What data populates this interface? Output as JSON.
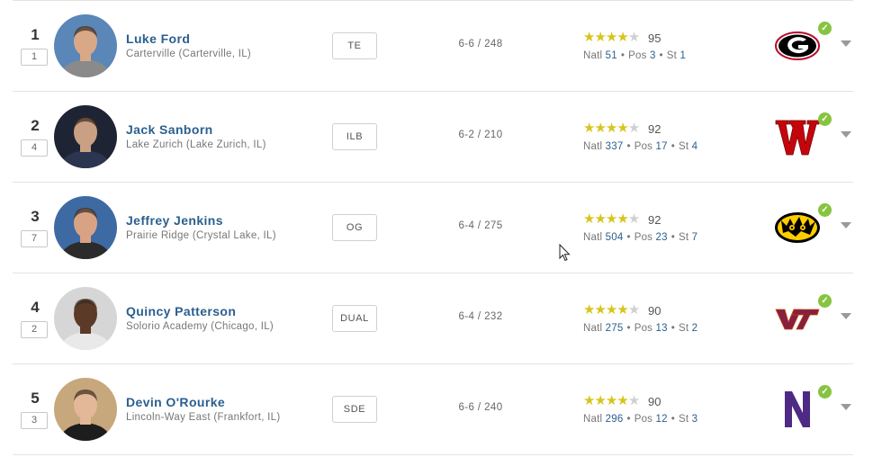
{
  "recruits": [
    {
      "rank": "1",
      "prev_rank": "1",
      "name": "Luke Ford",
      "school": "Carterville (Carterville, IL)",
      "position": "TE",
      "ht_wt": "6-6 / 248",
      "rating": "95",
      "stars_on": 4,
      "natl": "51",
      "pos_rank": "3",
      "st_rank": "1",
      "commit": "georgia-logo",
      "avatar_bg": "#5a86b8",
      "skin": "#d9a887",
      "shirt": "#8a8a8a"
    },
    {
      "rank": "2",
      "prev_rank": "4",
      "name": "Jack Sanborn",
      "school": "Lake Zurich (Lake Zurich, IL)",
      "position": "ILB",
      "ht_wt": "6-2 / 210",
      "rating": "92",
      "stars_on": 4,
      "natl": "337",
      "pos_rank": "17",
      "st_rank": "4",
      "commit": "wisconsin-logo",
      "avatar_bg": "#1e2433",
      "skin": "#c9a084",
      "shirt": "#2c3550"
    },
    {
      "rank": "3",
      "prev_rank": "7",
      "name": "Jeffrey Jenkins",
      "school": "Prairie Ridge (Crystal Lake, IL)",
      "position": "OG",
      "ht_wt": "6-4 / 275",
      "rating": "92",
      "stars_on": 4,
      "natl": "504",
      "pos_rank": "23",
      "st_rank": "7",
      "commit": "iowa-logo",
      "avatar_bg": "#3d6aa3",
      "skin": "#d8a385",
      "shirt": "#2b2b2b"
    },
    {
      "rank": "4",
      "prev_rank": "2",
      "name": "Quincy Patterson",
      "school": "Solorio Academy (Chicago, IL)",
      "position": "DUAL",
      "ht_wt": "6-4 / 232",
      "rating": "90",
      "stars_on": 4,
      "natl": "275",
      "pos_rank": "13",
      "st_rank": "2",
      "commit": "virginia-tech-logo",
      "avatar_bg": "#d6d6d6",
      "skin": "#5b3b28",
      "shirt": "#e9e9e9"
    },
    {
      "rank": "5",
      "prev_rank": "3",
      "name": "Devin O'Rourke",
      "school": "Lincoln-Way East (Frankfort, IL)",
      "position": "SDE",
      "ht_wt": "6-6 / 240",
      "rating": "90",
      "stars_on": 4,
      "natl": "296",
      "pos_rank": "12",
      "st_rank": "3",
      "commit": "northwestern-logo",
      "avatar_bg": "#c7a77c",
      "skin": "#e2b898",
      "shirt": "#1d1d1d"
    }
  ],
  "labels": {
    "natl": "Natl",
    "pos": "Pos",
    "st": "St",
    "bullet": "•",
    "check": "✓"
  }
}
